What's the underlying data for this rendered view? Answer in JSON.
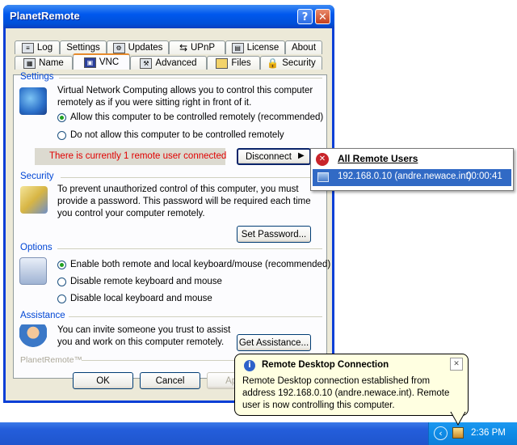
{
  "window": {
    "title": "PlanetRemote",
    "help_label": "?",
    "close_label": "✕"
  },
  "tabs_row1": [
    "Log",
    "Settings",
    "Updates",
    "UPnP",
    "License",
    "About"
  ],
  "tabs_row2": [
    "Name",
    "VNC",
    "Advanced",
    "Files",
    "Security"
  ],
  "settings": {
    "header": "Settings",
    "description": "Virtual Network Computing allows you to control this computer remotely as if you were sitting right in front of it.",
    "options": [
      "Allow this computer to be controlled remotely (recommended)",
      "Do not allow this computer to be controlled remotely"
    ],
    "selected": 0,
    "status": "There is currently 1 remote user connected",
    "disconnect_label": "Disconnect"
  },
  "security": {
    "header": "Security",
    "description": "To prevent unauthorized control of this computer, you must provide a password. This password will be required each time you control your computer remotely.",
    "button": "Set Password..."
  },
  "options": {
    "header": "Options",
    "items": [
      "Enable both remote and local keyboard/mouse (recommended)",
      "Disable remote keyboard and mouse",
      "Disable local keyboard and mouse"
    ],
    "selected": 0
  },
  "assistance": {
    "header": "Assistance",
    "description": "You can invite someone you trust to assist you and work on this computer remotely.",
    "button": "Get Assistance..."
  },
  "footer_brand": "PlanetRemote™",
  "dialog_buttons": {
    "ok": "OK",
    "cancel": "Cancel",
    "apply": "Apply"
  },
  "menu": {
    "header": "All Remote Users",
    "user": "192.168.0.10 (andre.newace.int)",
    "duration": "00:00:41"
  },
  "balloon": {
    "title": "Remote Desktop Connection",
    "body": "Remote Desktop connection established from address 192.168.0.10 (andre.newace.int). Remote user is now controlling this computer.",
    "close": "✕"
  },
  "taskbar": {
    "clock": "2:36 PM"
  },
  "colors": {
    "title_blue": "#0058ee",
    "section_blue": "#0046d5",
    "status_red": "#e00000",
    "balloon_bg": "#ffffe1"
  }
}
